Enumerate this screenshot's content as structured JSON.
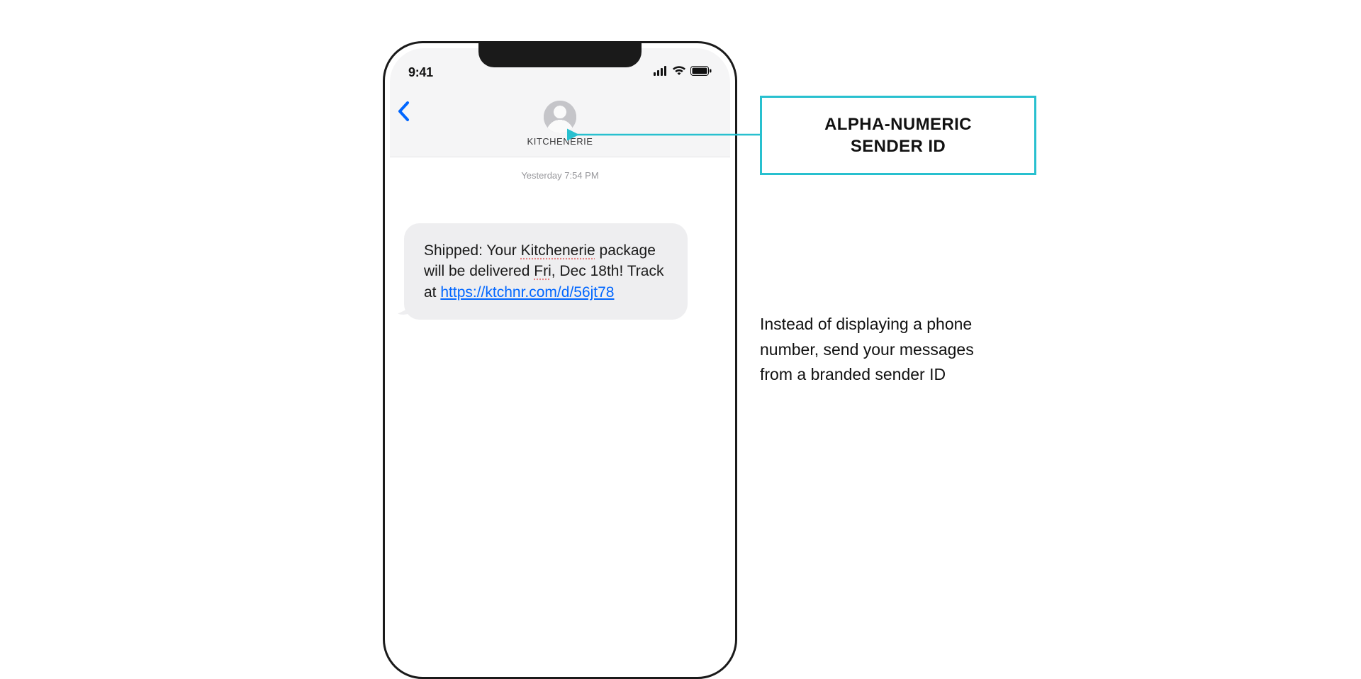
{
  "phone": {
    "status": {
      "time": "9:41"
    },
    "header": {
      "sender_name": "KITCHENERIE"
    },
    "conversation": {
      "timestamp": "Yesterday 7:54 PM",
      "message": {
        "prefix": "Shipped: Your ",
        "underlined1": "Kitchenerie",
        "mid1": " package will be delivered ",
        "underlined2": "Fri",
        "mid2": ", Dec 18th! Track at ",
        "link_text": "https://ktchnr.com/d/56jt78",
        "link_href": "https://ktchnr.com/d/56jt78"
      }
    }
  },
  "callout": {
    "title_line1": "ALPHA-NUMERIC",
    "title_line2": "SENDER ID"
  },
  "explanation": {
    "text": "Instead of displaying a phone number, send your messages from a branded sender ID"
  },
  "colors": {
    "accent": "#28c0cf",
    "link": "#0066ff"
  }
}
